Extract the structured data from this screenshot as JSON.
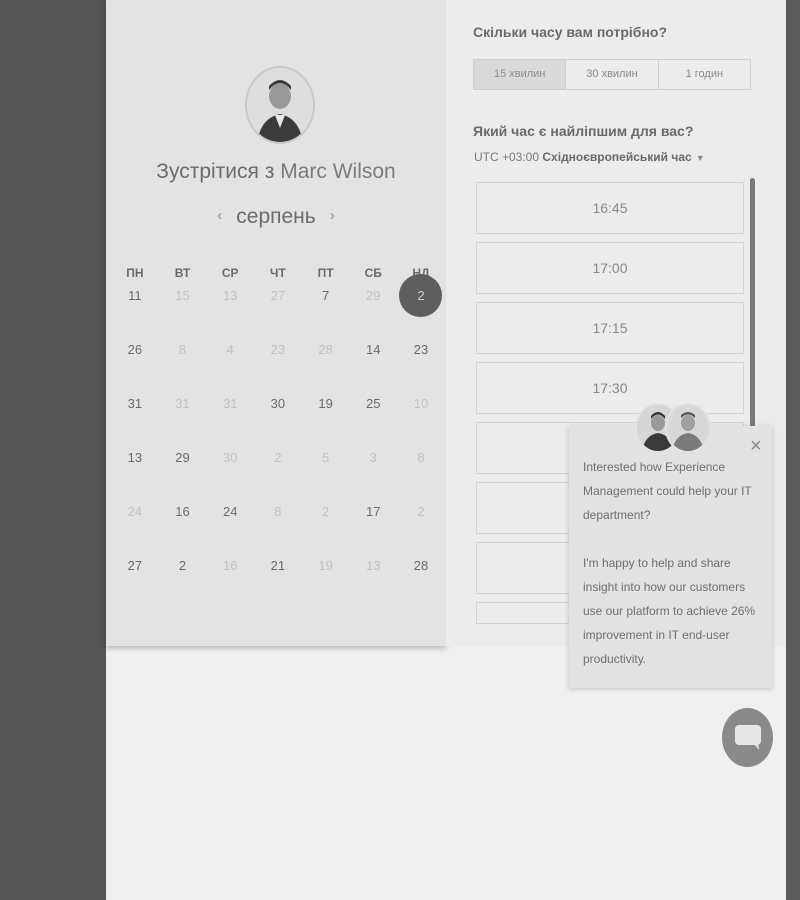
{
  "title": {
    "prefix": "Зустрітися з",
    "name": "Marc Wilson"
  },
  "calendar": {
    "month": "серпень",
    "prev_label": "‹",
    "next_label": "›",
    "weekdays": [
      "ПН",
      "ВТ",
      "СР",
      "ЧТ",
      "ПТ",
      "СБ",
      "НД"
    ],
    "rows": [
      [
        {
          "d": "11",
          "dim": false
        },
        {
          "d": "15",
          "dim": true
        },
        {
          "d": "13",
          "dim": true
        },
        {
          "d": "27",
          "dim": true
        },
        {
          "d": "7",
          "dim": false
        },
        {
          "d": "29",
          "dim": true
        },
        {
          "d": "2",
          "dim": false,
          "selected": true
        }
      ],
      [
        {
          "d": "26",
          "dim": false
        },
        {
          "d": "8",
          "dim": true
        },
        {
          "d": "4",
          "dim": true
        },
        {
          "d": "23",
          "dim": true
        },
        {
          "d": "28",
          "dim": true
        },
        {
          "d": "14",
          "dim": false
        },
        {
          "d": "23",
          "dim": false
        }
      ],
      [
        {
          "d": "31",
          "dim": false
        },
        {
          "d": "31",
          "dim": true
        },
        {
          "d": "31",
          "dim": true
        },
        {
          "d": "30",
          "dim": false
        },
        {
          "d": "19",
          "dim": false
        },
        {
          "d": "25",
          "dim": false
        },
        {
          "d": "10",
          "dim": true
        }
      ],
      [
        {
          "d": "13",
          "dim": false
        },
        {
          "d": "29",
          "dim": false
        },
        {
          "d": "30",
          "dim": true
        },
        {
          "d": "2",
          "dim": true
        },
        {
          "d": "5",
          "dim": true
        },
        {
          "d": "3",
          "dim": true
        },
        {
          "d": "8",
          "dim": true
        }
      ],
      [
        {
          "d": "24",
          "dim": true
        },
        {
          "d": "16",
          "dim": false
        },
        {
          "d": "24",
          "dim": false
        },
        {
          "d": "8",
          "dim": true
        },
        {
          "d": "2",
          "dim": true
        },
        {
          "d": "17",
          "dim": false
        },
        {
          "d": "2",
          "dim": true
        }
      ],
      [
        {
          "d": "27",
          "dim": false
        },
        {
          "d": "2",
          "dim": false
        },
        {
          "d": "16",
          "dim": true
        },
        {
          "d": "21",
          "dim": false
        },
        {
          "d": "19",
          "dim": true
        },
        {
          "d": "13",
          "dim": true
        },
        {
          "d": "28",
          "dim": false
        }
      ]
    ]
  },
  "booking": {
    "duration_question": "Скільки часу вам потрібно?",
    "durations": [
      "15 хвилин",
      "30 хвилин",
      "1 годин"
    ],
    "time_question": "Який час є найліпшим для вас?",
    "timezone_offset": "UTC +03:00",
    "timezone_name": "Східноєвропейський час",
    "slots": [
      "16:45",
      "17:00",
      "17:15",
      "17:30",
      "",
      "",
      "",
      ""
    ]
  },
  "chat": {
    "close_label": "×",
    "message_1": "Interested how Experience Management could help your IT department?",
    "message_2": "I'm happy to help and share insight into how our customers use our platform to achieve 26% improvement in IT end-user productivity."
  }
}
